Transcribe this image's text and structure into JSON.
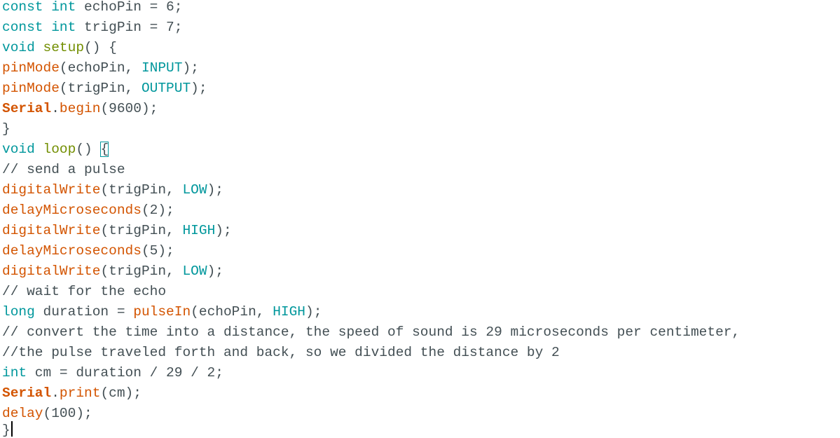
{
  "code": {
    "l1": {
      "a": "const",
      "b": " ",
      "c": "int",
      "d": " echoPin = 6;"
    },
    "l2": {
      "a": "const",
      "b": " ",
      "c": "int",
      "d": " trigPin = 7;"
    },
    "l3": {
      "a": "void",
      "b": " ",
      "c": "setup",
      "d": "() {"
    },
    "l4": {
      "a": "pinMode",
      "b": "(echoPin, ",
      "c": "INPUT",
      "d": ");"
    },
    "l5": {
      "a": "pinMode",
      "b": "(trigPin, ",
      "c": "OUTPUT",
      "d": ");"
    },
    "l6": {
      "a": "Serial",
      "b": ".",
      "c": "begin",
      "d": "(9600);"
    },
    "l7": {
      "a": "}"
    },
    "l8": {
      "a": "void",
      "b": " ",
      "c": "loop",
      "d": "() ",
      "e": "{"
    },
    "l9": {
      "a": "// send a pulse"
    },
    "l10": {
      "a": "digitalWrite",
      "b": "(trigPin, ",
      "c": "LOW",
      "d": ");"
    },
    "l11": {
      "a": "delayMicroseconds",
      "b": "(2);"
    },
    "l12": {
      "a": "digitalWrite",
      "b": "(trigPin, ",
      "c": "HIGH",
      "d": ");"
    },
    "l13": {
      "a": "delayMicroseconds",
      "b": "(5);"
    },
    "l14": {
      "a": "digitalWrite",
      "b": "(trigPin, ",
      "c": "LOW",
      "d": ");"
    },
    "l15": {
      "a": "// wait for the echo"
    },
    "l16": {
      "a": "long",
      "b": " duration = ",
      "c": "pulseIn",
      "d": "(echoPin, ",
      "e": "HIGH",
      "f": ");"
    },
    "l17": {
      "a": "// convert the time into a distance, the speed of sound is 29 microseconds per centimeter,"
    },
    "l18": {
      "a": "//the pulse traveled forth and back, so we divided the distance by 2"
    },
    "l19": {
      "a": "int",
      "b": " cm = duration / 29 / 2;"
    },
    "l20": {
      "a": "Serial",
      "b": ".",
      "c": "print",
      "d": "(cm);"
    },
    "l21": {
      "a": "delay",
      "b": "(100);"
    },
    "l22": {
      "a": "}"
    }
  },
  "colors": {
    "keyword": "#00979c",
    "function": "#d35400",
    "plain": "#434f54",
    "background": "#ffffff"
  }
}
